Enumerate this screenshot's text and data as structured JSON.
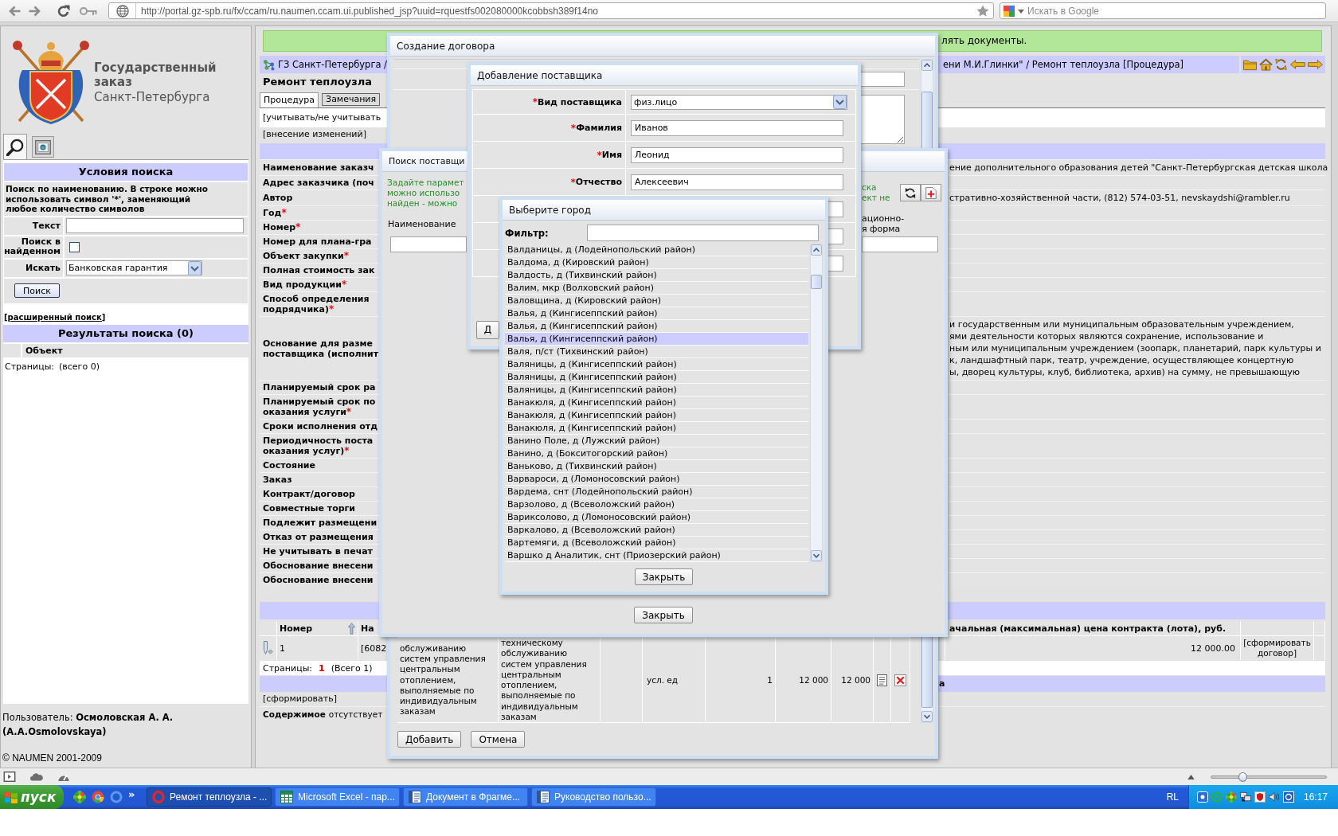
{
  "browser": {
    "url": "http://portal.gz-spb.ru/fx/ccam/ru.naumen.ccam.ui.published_jsp?uuid=rquestfs002080000kcobbsh389f14no",
    "search_placeholder": "Искать в Google"
  },
  "sidebar": {
    "logo": {
      "title": "Государственный заказ",
      "subtitle": "Санкт-Петербурга"
    },
    "tabs": [
      {
        "kind": "search",
        "selected": true
      },
      {
        "kind": "picture",
        "selected": false
      }
    ],
    "search": {
      "title": "Условия поиска",
      "hint": "Поиск по наименованию. В строке можно использовать символ '*', заменяющий любое количество символов",
      "fields": [
        {
          "kind": "text",
          "label": "Текст"
        },
        {
          "kind": "checkbox",
          "label": "Поиск в найденном",
          "checked": false
        },
        {
          "kind": "select",
          "label": "Искать",
          "value": "Банковская гарантия"
        }
      ],
      "button": "Поиск",
      "advanced_link": "[расширенный поиск]"
    },
    "results": {
      "title": "Результаты поиска (0)",
      "column": "Объект",
      "pages_label": "Страницы:",
      "total": "(всего 0)"
    },
    "user": "Пользователь: **Осмоловская А. А. (A.A.Osmolovskaya)**",
    "copyright": "© NAUMEN 2001-2009"
  },
  "main": {
    "notice": "лять документы.",
    "breadcrumb": {
      "root": "ГЗ Санкт-Петербурга /",
      "tail": "ени М.И.Глинки\" / Ремонт теплоузла [Процедура]"
    },
    "title": "Ремонт теплоузла",
    "tabs": [
      {
        "label": "Процедура",
        "selected": true
      },
      {
        "label": "Замечания",
        "selected": false
      }
    ],
    "links": [
      "[учитывать/не учитывать",
      "[внесение изменений]"
    ],
    "fields": [
      {
        "label": "Наименование заказч",
        "value": "ение дополнительного образования детей \"Санкт-Петербургская детская школа"
      },
      {
        "label": "Адрес заказчика (поч"
      },
      {
        "label": "Автор",
        "value": "стративно-хозяйственной части, (812) 574-03-51, nevskaydshi@rambler.ru"
      },
      {
        "label": "Год",
        "mark": "*"
      },
      {
        "label": "Номер",
        "mark": "*"
      },
      {
        "label": "Номер для плана-гра"
      },
      {
        "label": "Объект закупки",
        "mark": "*"
      },
      {
        "label": "Полная стоимость зак"
      },
      {
        "label": "Вид продукции",
        "mark": "*"
      },
      {
        "label": "Способ определения\nподрядчика)",
        "mark": "*"
      },
      {
        "label": "Основание для разме\nпоставщика (исполнит",
        "value": "и государственным или муниципальным образовательным учреждением,\nями деятельности которых являются сохранение, использование и\nным или муниципальным учреждением (зоопарк, планетарий, парк культуры и\nк, ландшафтный парк, театр, учреждение, осуществляющее концертную\nы, дворец культуры, клуб, библиотека, архив) на сумму, не превышающую"
      },
      {
        "label": "Планируемый срок ра"
      },
      {
        "label": "Планируемый срок по\nоказания услуги",
        "mark": "*"
      },
      {
        "label": "Сроки исполнения отд"
      },
      {
        "label": "Периодичность поста\nоказания услуг)",
        "mark": "*"
      },
      {
        "label": "Состояние"
      },
      {
        "label": "Заказ"
      },
      {
        "label": "Контракт/договор"
      },
      {
        "label": "Совместные торги"
      },
      {
        "label": "Подлежит размещени"
      },
      {
        "label": "Отказ от размещения"
      },
      {
        "label": "Не учитывать в печат"
      },
      {
        "label": "Обоснование внесени"
      },
      {
        "label": "Обоснование внесени"
      }
    ],
    "table": {
      "columns": [
        {
          "label": "Номер",
          "sorted": true
        },
        {
          "label": "На"
        },
        {
          "label": "ачальная (максимальная) цена контракта (лота), руб."
        }
      ],
      "rows": [
        {
          "number": "1",
          "column_2": "[6082",
          "price": "12 000.00",
          "action": "[сформировать договор]"
        }
      ]
    },
    "pagination": {
      "label": "Страницы:",
      "pages": [
        {
          "label": "1",
          "selected": true
        }
      ],
      "total": "(Всего 1)"
    },
    "section_tail": "а",
    "form_link": "[сформировать]",
    "content": {
      "label": "Содержимое",
      "value": "отсутствует"
    }
  },
  "dialogs": {
    "contract": {
      "title": "Создание договора",
      "rows": [
        {
          "column_1": "обслуживанию\nсистем управления\nцентральным\nотоплением,\nвыполняемые по\nиндивидуальным\nзаказам",
          "column_2": "техническому\nобслуживанию\nсистем управления\nцентральным\nотоплением,\nвыполняемые по\nиндивидуальным\nзаказам",
          "column_4": "усл. ед",
          "column_5": "1",
          "column_6": "12 000",
          "column_7": "12 000"
        }
      ],
      "buttons": [
        "Добавить",
        "Отмена"
      ]
    },
    "supplier_search": {
      "title": "Поиск поставщи",
      "hint_left": "Задайте парамет\nможно использо\nнайден - можно",
      "hint_right": "ска\nект не",
      "header_left": "Наименование",
      "header_right": "ационно-\nя форма",
      "close": "Закрыть"
    },
    "supplier": {
      "title": "Добавление поставщика",
      "fields": [
        {
          "kind": "select",
          "mark": "*",
          "label": "Вид поставщика",
          "value": "физ.лицо"
        },
        {
          "kind": "text",
          "mark": "*",
          "label": "Фамилия",
          "value": "Иванов"
        },
        {
          "kind": "text",
          "mark": "*",
          "label": "Имя",
          "value": "Леонид"
        },
        {
          "kind": "text",
          "mark": "*",
          "label": "Отчество",
          "value": "Алексеевич"
        },
        {
          "kind": "text"
        },
        {
          "kind": "text"
        },
        {
          "kind": "text"
        }
      ],
      "button": "Д"
    },
    "city": {
      "title": "Выберите город",
      "filter_label": "Фильтр:",
      "items": [
        {
          "label": "Валданицы, д (Лодейнопольский район)",
          "selected": false
        },
        {
          "label": "Валдома, д (Кировский район)",
          "selected": false
        },
        {
          "label": "Валдость, д (Тихвинский район)",
          "selected": false
        },
        {
          "label": "Валим, мкр (Волховский район)",
          "selected": false
        },
        {
          "label": "Валовщина, д (Кировский район)",
          "selected": false
        },
        {
          "label": "Валья, д (Кингисеппский район)",
          "selected": false
        },
        {
          "label": "Валья, д (Кингисеппский район)",
          "selected": false
        },
        {
          "label": "Валья, д (Кингисеппский район)",
          "selected": true
        },
        {
          "label": "Валя, п/ст (Тихвинский район)",
          "selected": false
        },
        {
          "label": "Валяницы, д (Кингисеппский район)",
          "selected": false
        },
        {
          "label": "Валяницы, д (Кингисеппский район)",
          "selected": false
        },
        {
          "label": "Валяницы, д (Кингисеппский район)",
          "selected": false
        },
        {
          "label": "Ванакюля, д (Кингисеппский район)",
          "selected": false
        },
        {
          "label": "Ванакюля, д (Кингисеппский район)",
          "selected": false
        },
        {
          "label": "Ванакюля, д (Кингисеппский район)",
          "selected": false
        },
        {
          "label": "Ванино Поле, д (Лужский район)",
          "selected": false
        },
        {
          "label": "Ванино, д (Бокситогорский район)",
          "selected": false
        },
        {
          "label": "Ваньково, д (Тихвинский район)",
          "selected": false
        },
        {
          "label": "Варвароси, д (Ломоносовский район)",
          "selected": false
        },
        {
          "label": "Вардема, снт (Лодейнопольский район)",
          "selected": false
        },
        {
          "label": "Варзолово, д (Всеволожский район)",
          "selected": false
        },
        {
          "label": "Вариксолово, д (Ломоносовский район)",
          "selected": false
        },
        {
          "label": "Варкалово, д (Всеволожский район)",
          "selected": false
        },
        {
          "label": "Вартемяги, д (Всеволожский район)",
          "selected": false
        },
        {
          "label": "Варшко д Аналитик, снт (Приозерский район)",
          "selected": false
        }
      ],
      "close": "Закрыть"
    }
  },
  "status_bar": {
    "zoom": {
      "level": 0.27
    }
  },
  "taskbar": {
    "start": "пуск",
    "more": "»",
    "tasks": [
      {
        "kind": "browser",
        "label": "Ремонт теплоузла - ...",
        "selected": true
      },
      {
        "kind": "spreadsheet",
        "label": "Microsoft Excel - пар...",
        "selected": false
      },
      {
        "kind": "document",
        "label": "Документ в Фрагме...",
        "selected": false
      },
      {
        "kind": "document",
        "label": "Руководство пользо...",
        "selected": false
      }
    ],
    "language": "RL",
    "clock": "16:17"
  }
}
